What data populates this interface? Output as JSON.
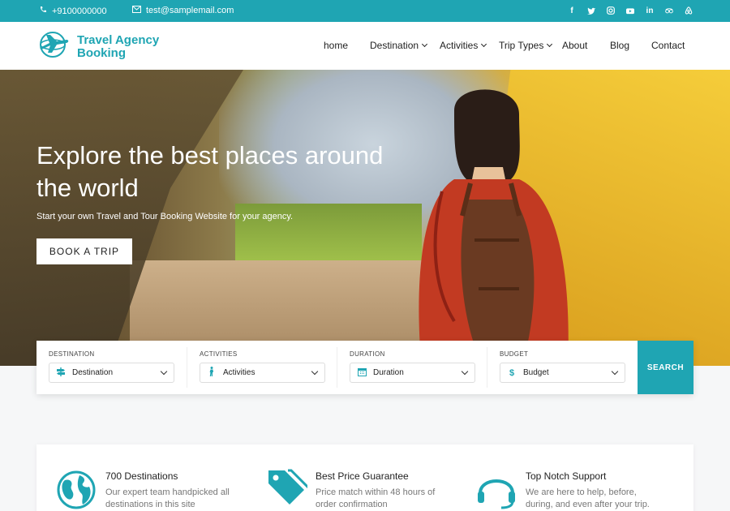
{
  "topbar": {
    "phone": "+9100000000",
    "email": "test@samplemail.com",
    "social": [
      "facebook-icon",
      "twitter-icon",
      "instagram-icon",
      "youtube-icon",
      "linkedin-icon",
      "tripadvisor-icon",
      "airbnb-icon"
    ]
  },
  "brand": {
    "line1": "Travel Agency",
    "line2": "Booking"
  },
  "nav": [
    {
      "label": "home",
      "dropdown": false
    },
    {
      "label": "Destination",
      "dropdown": true
    },
    {
      "label": "Activities",
      "dropdown": true
    },
    {
      "label": "Trip Types",
      "dropdown": true
    },
    {
      "label": "About",
      "dropdown": false
    },
    {
      "label": "Blog",
      "dropdown": false
    },
    {
      "label": "Contact",
      "dropdown": false
    }
  ],
  "hero": {
    "title": "Explore the best places around the world",
    "subtitle": "Start your own Travel and Tour Booking Website for your agency.",
    "cta": "BOOK A TRIP"
  },
  "search": {
    "fields": [
      {
        "label": "DESTINATION",
        "value": "Destination",
        "icon": "signpost-icon"
      },
      {
        "label": "ACTIVITIES",
        "value": "Activities",
        "icon": "hiker-icon"
      },
      {
        "label": "DURATION",
        "value": "Duration",
        "icon": "calendar-icon"
      },
      {
        "label": "BUDGET",
        "value": "Budget",
        "icon": "dollar-icon"
      }
    ],
    "button": "SEARCH"
  },
  "features": [
    {
      "title": "700 Destinations",
      "desc": "Our expert team handpicked all destinations in this site",
      "icon": "globe-icon"
    },
    {
      "title": "Best Price Guarantee",
      "desc": "Price match within 48 hours of order confirmation",
      "icon": "price-tag-icon"
    },
    {
      "title": "Top Notch Support",
      "desc": "We are here to help, before, during, and even after your trip.",
      "icon": "headset-icon"
    }
  ],
  "colors": {
    "accent": "#1fa5b3"
  }
}
